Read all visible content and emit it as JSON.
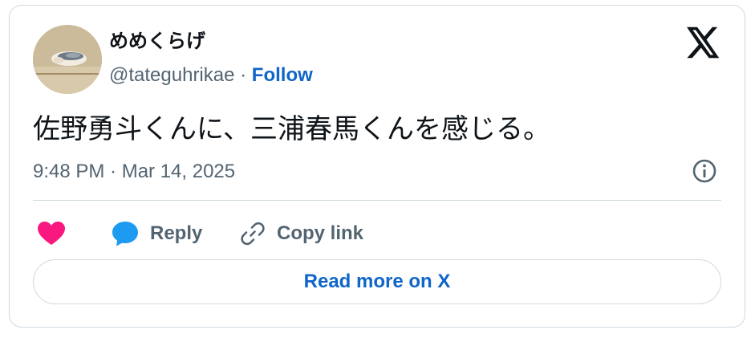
{
  "author": {
    "display_name": "めめくらげ",
    "handle": "@tateguhrikae",
    "separator": " · ",
    "follow_label": "Follow"
  },
  "tweet": {
    "text": "佐野勇斗くんに、三浦春馬くんを感じる。",
    "timestamp": "9:48 PM · Mar 14, 2025"
  },
  "actions": {
    "reply_label": "Reply",
    "copy_label": "Copy link"
  },
  "footer": {
    "read_more_label": "Read more on X"
  },
  "colors": {
    "link": "#0f65c9",
    "muted": "#536471",
    "text": "#0f1419",
    "like": "#f91880",
    "reply": "#1d9bf0",
    "border": "#cfd9de"
  },
  "icons": [
    "x-logo-icon",
    "info-icon",
    "heart-icon",
    "reply-bubble-icon",
    "link-icon"
  ]
}
